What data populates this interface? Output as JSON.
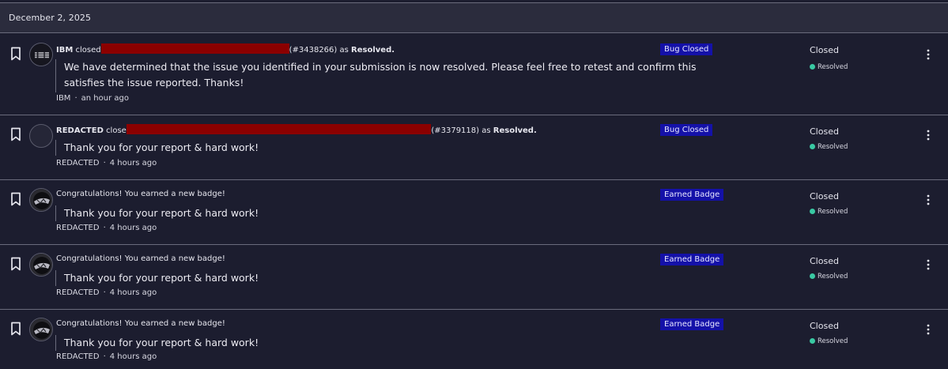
{
  "date_header": "December 2, 2025",
  "rows": [
    {
      "title": {
        "actor": "IBM",
        "verb": "closed",
        "report_id": "(#3438266)",
        "as_text": "as",
        "state": "Resolved."
      },
      "message_line1": "We have determined that the issue you identified in your submission is now resolved. Please feel free to retest and confirm this",
      "message_line2": "satisfies the issue reported. Thanks!",
      "meta_author": "IBM",
      "meta_time": "an hour ago",
      "tag": "Bug Closed",
      "status": "Closed",
      "substatus": "Resolved",
      "avatar_icon": "ibm-logo-avatar"
    },
    {
      "title": {
        "actor": "REDACTED",
        "verb": "closec",
        "report_id": "(#3379118)",
        "as_text": "as",
        "state": "Resolved."
      },
      "message": "Thank you for your report & hard work!",
      "meta_author": "REDACTED",
      "meta_time": "4 hours ago",
      "tag": "Bug Closed",
      "status": "Closed",
      "substatus": "Resolved",
      "avatar_icon": "blank-avatar"
    },
    {
      "title_text": "Congratulations! You earned a new badge!",
      "message": "Thank you for your report & hard work!",
      "meta_author": "REDACTED",
      "meta_time": "4 hours ago",
      "tag": "Earned Badge",
      "status": "Closed",
      "substatus": "Resolved",
      "avatar_icon": "badge-avatar"
    },
    {
      "title_text": "Congratulations! You earned a new badge!",
      "message": "Thank you for your report & hard work!",
      "meta_author": "REDACTED",
      "meta_time": "4 hours ago",
      "tag": "Earned Badge",
      "status": "Closed",
      "substatus": "Resolved",
      "avatar_icon": "badge-avatar"
    },
    {
      "title_text": "Congratulations! You earned a new badge!",
      "message": "Thank you for your report & hard work!",
      "meta_author": "REDACTED",
      "meta_time": "4 hours ago",
      "tag": "Earned Badge",
      "status": "Closed",
      "substatus": "Resolved",
      "avatar_icon": "badge-avatar"
    }
  ],
  "colors": {
    "background": "#1c1d2f",
    "header_bg": "#2b2c3d",
    "tag_bg": "#1411a8",
    "redaction": "#8b0000",
    "resolved_dot": "#39c9a3"
  }
}
